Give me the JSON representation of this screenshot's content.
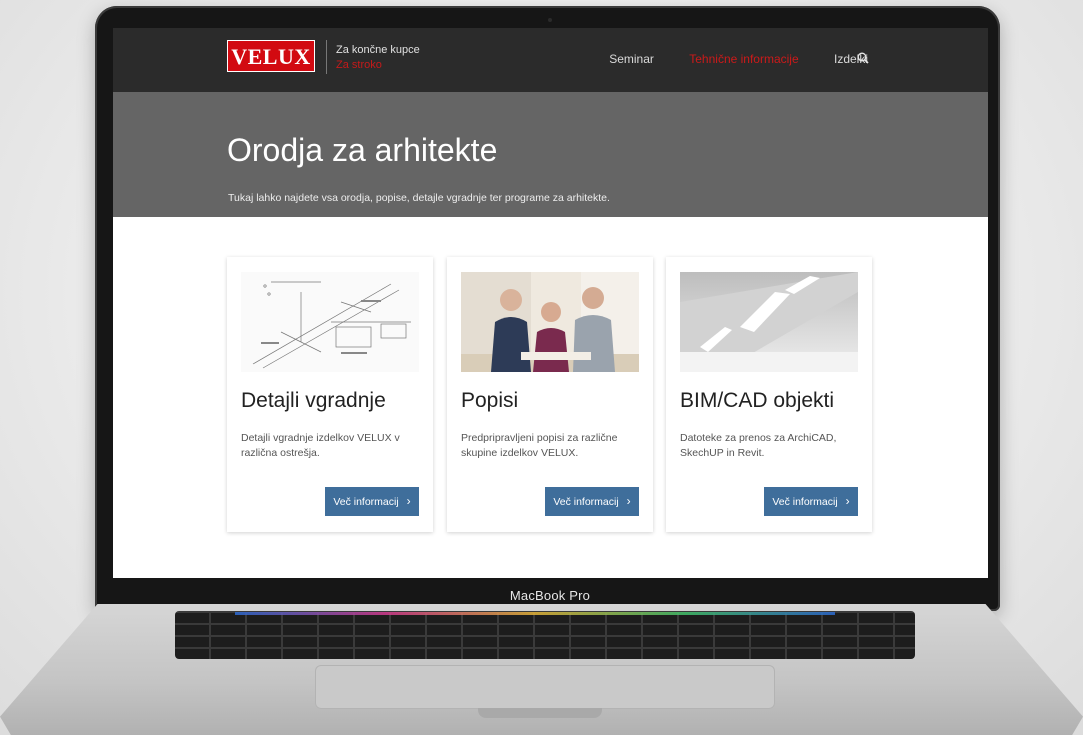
{
  "device": {
    "label": "MacBook Pro"
  },
  "header": {
    "logo_text": "VELUX",
    "audience_primary": "Za končne kupce",
    "audience_secondary": "Za stroko",
    "nav": [
      {
        "label": "Seminar",
        "active": false
      },
      {
        "label": "Tehnične informacije",
        "active": true
      },
      {
        "label": "Izdelki",
        "active": false
      }
    ],
    "search_icon": "search-icon"
  },
  "hero": {
    "title": "Orodja za arhitekte",
    "subtitle": "Tukaj lahko najdete vsa orodja, popise, detajle vgradnje ter programe za arhitekte."
  },
  "cards": [
    {
      "title": "Detajli vgradnje",
      "description": "Detajli vgradnje izdelkov VELUX v različna ostrešja.",
      "button_label": "Več informacij",
      "image_icon": "technical-drawing-icon"
    },
    {
      "title": "Popisi",
      "description": "Predpripravljeni popisi za različne skupine izdelkov VELUX.",
      "button_label": "Več informacij",
      "image_icon": "people-photo-icon"
    },
    {
      "title": "BIM/CAD objekti",
      "description": "Datoteke za prenos za ArchiCAD, SkechUP in Revit.",
      "button_label": "Več informacij",
      "image_icon": "roof-window-render-icon"
    }
  ],
  "colors": {
    "brand_red": "#d20a11",
    "header_bg": "#2b2b2b",
    "hero_bg": "#656565",
    "button_blue": "#3f6e9b",
    "nav_active": "#cc1a1a"
  }
}
